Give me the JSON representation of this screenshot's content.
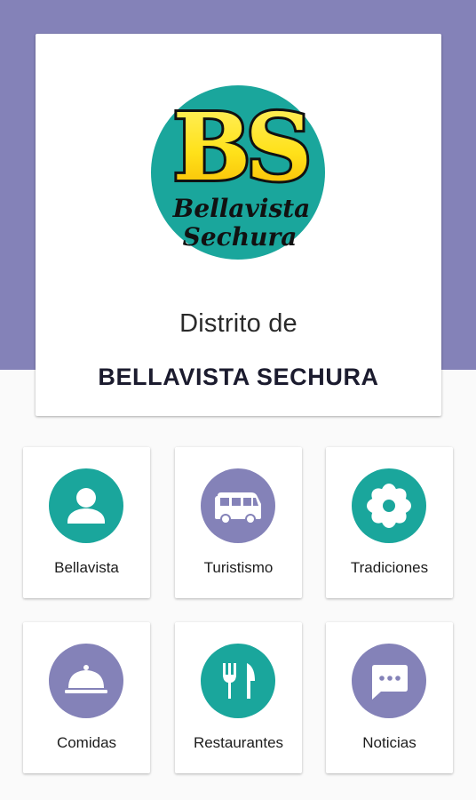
{
  "colors": {
    "header_band": "#8482b8",
    "teal": "#1aa69c",
    "purple": "#8482b8",
    "card": "#ffffff",
    "background": "#fafafa"
  },
  "hero": {
    "logo": {
      "initials": "BS",
      "line1": "Bellavista",
      "line2": "Sechura"
    },
    "subtitle": "Distrito de",
    "title": "BELLAVISTA SECHURA"
  },
  "menu": [
    {
      "label": "Bellavista",
      "icon": "person-icon",
      "color": "teal"
    },
    {
      "label": "Turistismo",
      "icon": "bus-icon",
      "color": "purple"
    },
    {
      "label": "Tradiciones",
      "icon": "flower-icon",
      "color": "teal"
    },
    {
      "label": "Comidas",
      "icon": "cloche-icon",
      "color": "purple"
    },
    {
      "label": "Restaurantes",
      "icon": "restaurant-icon",
      "color": "teal"
    },
    {
      "label": "Noticias",
      "icon": "message-icon",
      "color": "purple"
    }
  ]
}
